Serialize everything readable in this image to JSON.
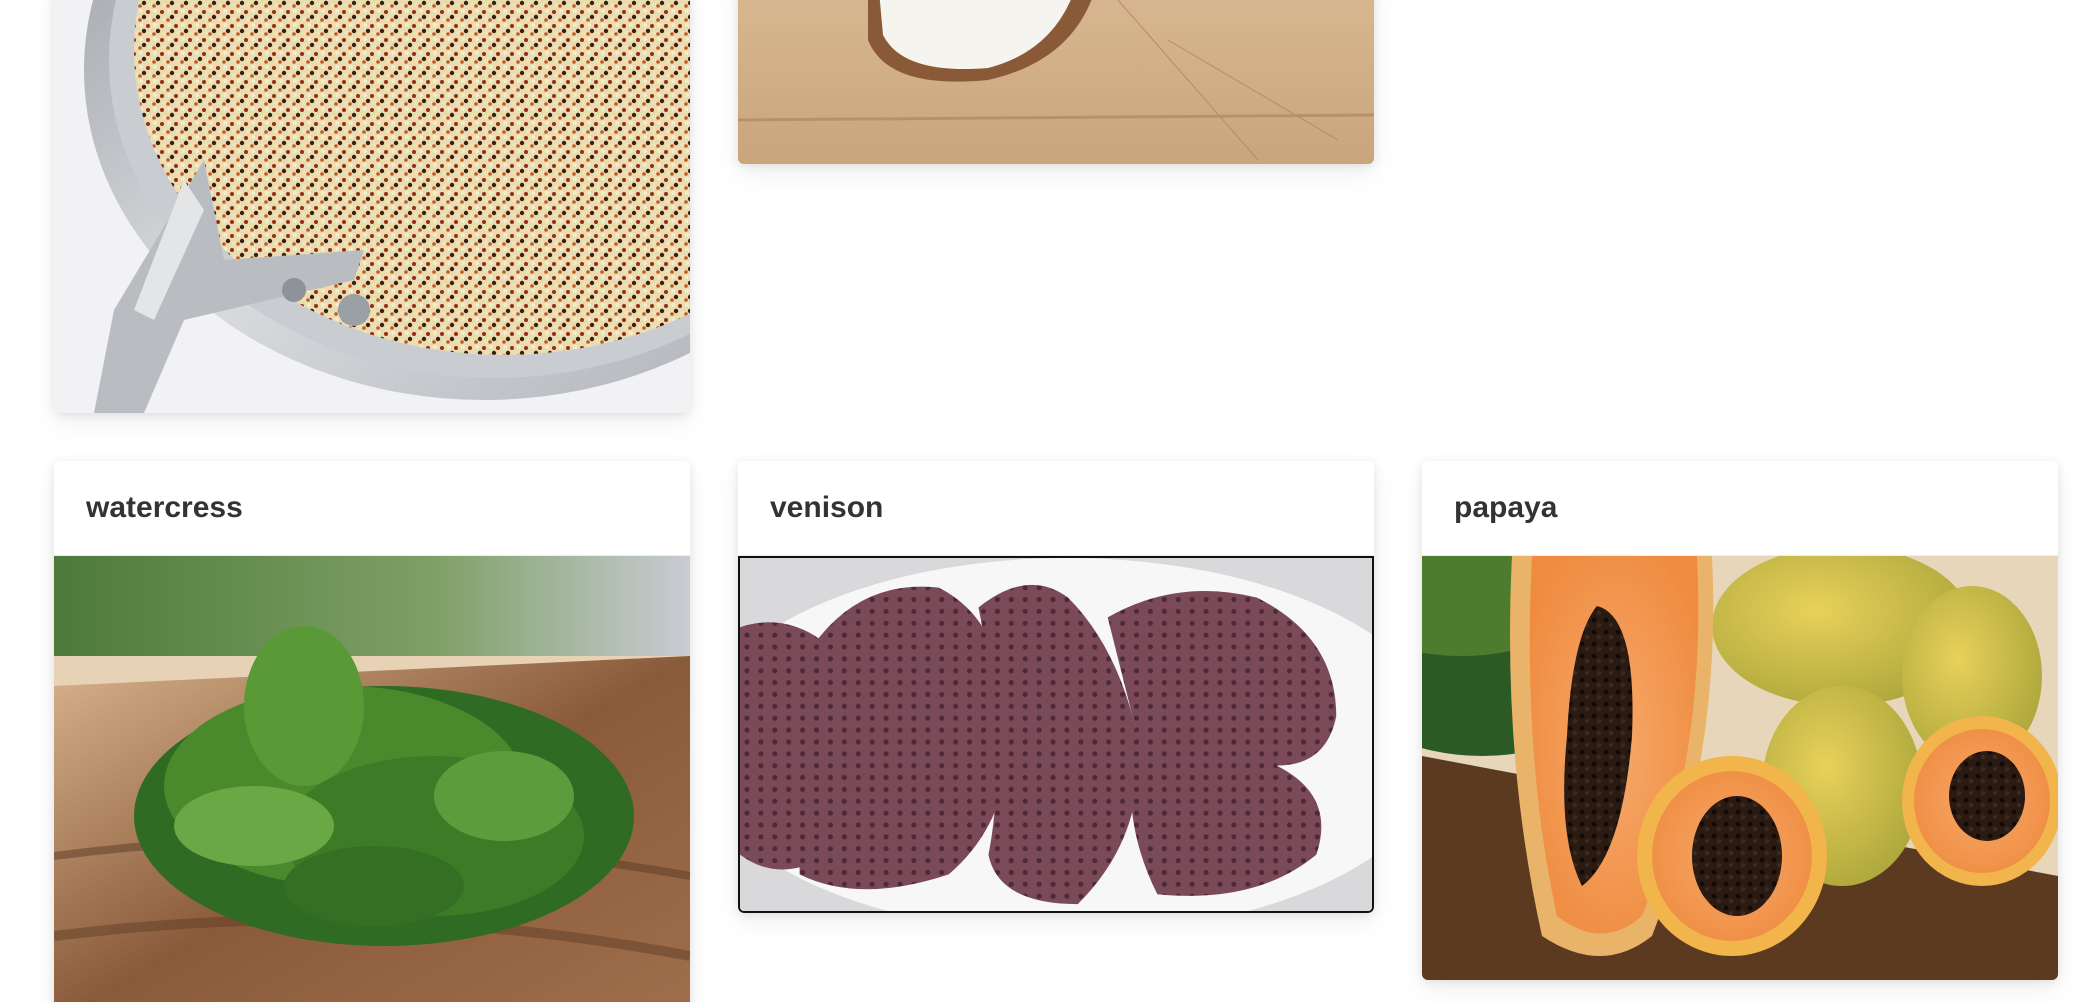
{
  "cards": [
    {
      "title": "",
      "image": "quinoa-in-pot-photo"
    },
    {
      "title": "",
      "image": "coconut-on-cutting-board-photo"
    },
    {
      "title": "watercress",
      "image": "watercress-on-wood-board-photo"
    },
    {
      "title": "venison",
      "image": "venison-steaks-on-plate-photo"
    },
    {
      "title": "papaya",
      "image": "papaya-halves-photo"
    }
  ]
}
